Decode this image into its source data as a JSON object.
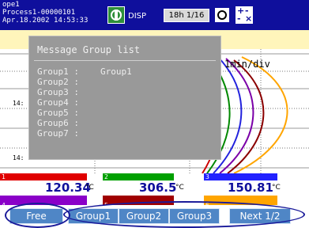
{
  "header": {
    "line1": "ope1",
    "line2": "Process1-00000101",
    "line3": "Apr.18.2002 14:53:33",
    "disp_label": "DISP",
    "time_button": "18h 1/16",
    "icons": [
      "group-icon",
      "snapshot-icon",
      "plus-minus-icon"
    ]
  },
  "chart": {
    "scale_label": "1min/div",
    "time_labels": [
      "14:",
      "14:"
    ],
    "trace_colors": [
      "#cc0000",
      "#008800",
      "#2222dd",
      "#7b00a8",
      "#8b0000",
      "#ffa500"
    ]
  },
  "dialog": {
    "title": "Message Group list",
    "groups": [
      {
        "label": "Group1 :",
        "value": "Group1"
      },
      {
        "label": "Group2 :",
        "value": ""
      },
      {
        "label": "Group3 :",
        "value": ""
      },
      {
        "label": "Group4 :",
        "value": ""
      },
      {
        "label": "Group5 :",
        "value": ""
      },
      {
        "label": "Group6 :",
        "value": ""
      },
      {
        "label": "Group7 :",
        "value": ""
      }
    ]
  },
  "channels": [
    {
      "num": "1",
      "value": "120.34",
      "unit": "°C",
      "color": "#e00000"
    },
    {
      "num": "2",
      "value": "306.5",
      "unit": "°C",
      "color": "#00a000"
    },
    {
      "num": "3",
      "value": "150.81",
      "unit": "°C",
      "color": "#2222ff"
    }
  ],
  "row2_channels": [
    {
      "num": "4",
      "color": "#8a00c8"
    },
    {
      "num": "5",
      "color": "#a00000"
    },
    {
      "num": "6",
      "color": "#ffa500"
    }
  ],
  "softkeys": {
    "free": "Free",
    "group1": "Group1",
    "group2": "Group2",
    "group3": "Group3",
    "next": "Next 1/2"
  }
}
